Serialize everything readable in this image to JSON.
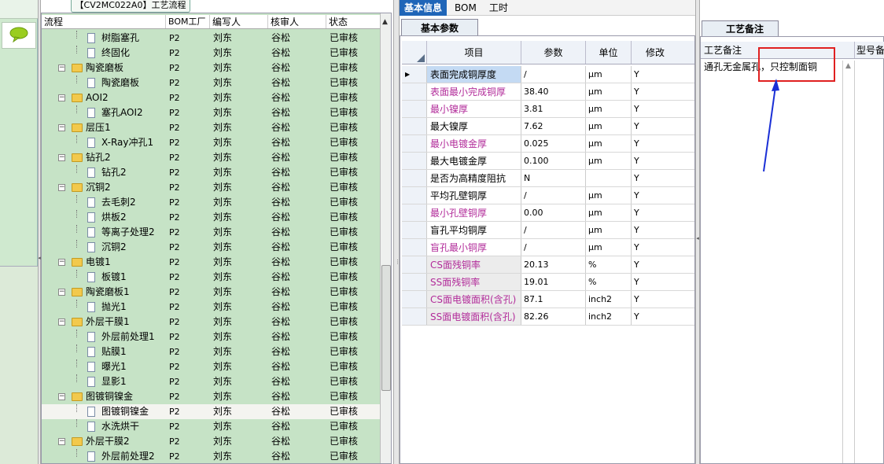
{
  "window": {
    "tree_tab_title": "【CV2MC022A0】工艺流程"
  },
  "tree": {
    "columns": [
      "流程",
      "BOM工厂",
      "编写人",
      "核审人",
      "状态"
    ],
    "rows": [
      {
        "kind": "child",
        "label": "树脂塞孔",
        "bom": "P2",
        "author": "刘东",
        "reviewer": "谷松",
        "status": "已审核"
      },
      {
        "kind": "child",
        "label": "终固化",
        "bom": "P2",
        "author": "刘东",
        "reviewer": "谷松",
        "status": "已审核"
      },
      {
        "kind": "folder",
        "label": "陶瓷磨板",
        "bom": "P2",
        "author": "刘东",
        "reviewer": "谷松",
        "status": "已审核"
      },
      {
        "kind": "child",
        "label": "陶瓷磨板",
        "bom": "P2",
        "author": "刘东",
        "reviewer": "谷松",
        "status": "已审核"
      },
      {
        "kind": "folder",
        "label": "AOI2",
        "bom": "P2",
        "author": "刘东",
        "reviewer": "谷松",
        "status": "已审核"
      },
      {
        "kind": "child",
        "label": "塞孔AOI2",
        "bom": "P2",
        "author": "刘东",
        "reviewer": "谷松",
        "status": "已审核"
      },
      {
        "kind": "folder",
        "label": "层压1",
        "bom": "P2",
        "author": "刘东",
        "reviewer": "谷松",
        "status": "已审核"
      },
      {
        "kind": "child",
        "label": "X-Ray冲孔1",
        "bom": "P2",
        "author": "刘东",
        "reviewer": "谷松",
        "status": "已审核"
      },
      {
        "kind": "folder",
        "label": "钻孔2",
        "bom": "P2",
        "author": "刘东",
        "reviewer": "谷松",
        "status": "已审核"
      },
      {
        "kind": "child",
        "label": "钻孔2",
        "bom": "P2",
        "author": "刘东",
        "reviewer": "谷松",
        "status": "已审核"
      },
      {
        "kind": "folder",
        "label": "沉铜2",
        "bom": "P2",
        "author": "刘东",
        "reviewer": "谷松",
        "status": "已审核"
      },
      {
        "kind": "child",
        "label": "去毛刺2",
        "bom": "P2",
        "author": "刘东",
        "reviewer": "谷松",
        "status": "已审核"
      },
      {
        "kind": "child",
        "label": "烘板2",
        "bom": "P2",
        "author": "刘东",
        "reviewer": "谷松",
        "status": "已审核"
      },
      {
        "kind": "child",
        "label": "等离子处理2",
        "bom": "P2",
        "author": "刘东",
        "reviewer": "谷松",
        "status": "已审核"
      },
      {
        "kind": "child",
        "label": "沉铜2",
        "bom": "P2",
        "author": "刘东",
        "reviewer": "谷松",
        "status": "已审核"
      },
      {
        "kind": "folder",
        "label": "电镀1",
        "bom": "P2",
        "author": "刘东",
        "reviewer": "谷松",
        "status": "已审核"
      },
      {
        "kind": "child",
        "label": "板镀1",
        "bom": "P2",
        "author": "刘东",
        "reviewer": "谷松",
        "status": "已审核"
      },
      {
        "kind": "folder",
        "label": "陶瓷磨板1",
        "bom": "P2",
        "author": "刘东",
        "reviewer": "谷松",
        "status": "已审核"
      },
      {
        "kind": "child",
        "label": "抛光1",
        "bom": "P2",
        "author": "刘东",
        "reviewer": "谷松",
        "status": "已审核"
      },
      {
        "kind": "folder",
        "label": "外层干膜1",
        "bom": "P2",
        "author": "刘东",
        "reviewer": "谷松",
        "status": "已审核"
      },
      {
        "kind": "child",
        "label": "外层前处理1",
        "bom": "P2",
        "author": "刘东",
        "reviewer": "谷松",
        "status": "已审核"
      },
      {
        "kind": "child",
        "label": "贴膜1",
        "bom": "P2",
        "author": "刘东",
        "reviewer": "谷松",
        "status": "已审核"
      },
      {
        "kind": "child",
        "label": "曝光1",
        "bom": "P2",
        "author": "刘东",
        "reviewer": "谷松",
        "status": "已审核"
      },
      {
        "kind": "child",
        "label": "显影1",
        "bom": "P2",
        "author": "刘东",
        "reviewer": "谷松",
        "status": "已审核"
      },
      {
        "kind": "folder",
        "label": "图镀铜镍金",
        "bom": "P2",
        "author": "刘东",
        "reviewer": "谷松",
        "status": "已审核"
      },
      {
        "kind": "child",
        "label": "图镀铜镍金",
        "bom": "P2",
        "author": "刘东",
        "reviewer": "谷松",
        "status": "已审核",
        "selected": true
      },
      {
        "kind": "child",
        "label": "水洗烘干",
        "bom": "P2",
        "author": "刘东",
        "reviewer": "谷松",
        "status": "已审核"
      },
      {
        "kind": "folder",
        "label": "外层干膜2",
        "bom": "P2",
        "author": "刘东",
        "reviewer": "谷松",
        "status": "已审核"
      },
      {
        "kind": "child",
        "label": "外层前处理2",
        "bom": "P2",
        "author": "刘东",
        "reviewer": "谷松",
        "status": "已审核"
      }
    ]
  },
  "middle": {
    "tabs": [
      "基本信息",
      "BOM",
      "工时"
    ],
    "subtab": "基本参数",
    "columns": [
      "项目",
      "参数",
      "单位",
      "修改"
    ],
    "rows": [
      {
        "item": "表面完成铜厚度",
        "param": "/",
        "unit": "μm",
        "edit": "Y",
        "style": "sel",
        "current": true
      },
      {
        "item": "表面最小完成铜厚",
        "param": "38.40",
        "unit": "μm",
        "edit": "Y",
        "style": "pink"
      },
      {
        "item": "最小镍厚",
        "param": "3.81",
        "unit": "μm",
        "edit": "Y",
        "style": "pink"
      },
      {
        "item": "最大镍厚",
        "param": "7.62",
        "unit": "μm",
        "edit": "Y",
        "style": "normal"
      },
      {
        "item": "最小电镀金厚",
        "param": "0.025",
        "unit": "μm",
        "edit": "Y",
        "style": "pink"
      },
      {
        "item": "最大电镀金厚",
        "param": "0.100",
        "unit": "μm",
        "edit": "Y",
        "style": "normal"
      },
      {
        "item": "是否为高精度阻抗",
        "param": "N",
        "unit": "",
        "edit": "Y",
        "style": "normal"
      },
      {
        "item": "平均孔壁铜厚",
        "param": "/",
        "unit": "μm",
        "edit": "Y",
        "style": "normal"
      },
      {
        "item": "最小孔壁铜厚",
        "param": "0.00",
        "unit": "μm",
        "edit": "Y",
        "style": "pink"
      },
      {
        "item": "盲孔平均铜厚",
        "param": "/",
        "unit": "μm",
        "edit": "Y",
        "style": "normal"
      },
      {
        "item": "盲孔最小铜厚",
        "param": "/",
        "unit": "μm",
        "edit": "Y",
        "style": "pink"
      },
      {
        "item": "CS面残铜率",
        "param": "20.13",
        "unit": "%",
        "edit": "Y",
        "style": "pink-grey"
      },
      {
        "item": "SS面残铜率",
        "param": "19.01",
        "unit": "%",
        "edit": "Y",
        "style": "pink-grey"
      },
      {
        "item": "CS面电镀面积(含孔)",
        "param": "87.1",
        "unit": "inch2",
        "edit": "Y",
        "style": "pink-grey"
      },
      {
        "item": "SS面电镀面积(含孔)",
        "param": "82.26",
        "unit": "inch2",
        "edit": "Y",
        "style": "pink-grey"
      }
    ]
  },
  "right": {
    "subtab": "工艺备注",
    "columns": [
      "工艺备注",
      "型号备"
    ],
    "note": "通孔无金属孔，只控制面铜"
  },
  "colors": {
    "tree_bg": "#c6e3c6",
    "tab_active": "#1f65b8",
    "pink_text": "#b22c9a",
    "annotation_red": "#e02020",
    "arrow_blue": "#1a2fd6"
  }
}
